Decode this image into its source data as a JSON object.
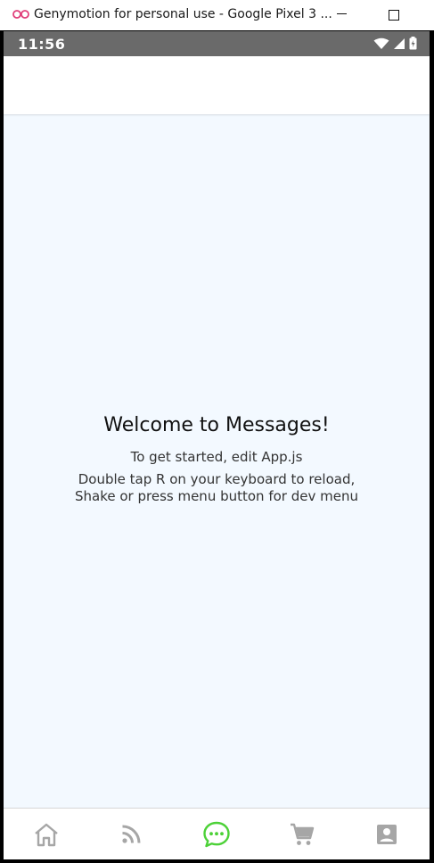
{
  "window": {
    "title": "Genymotion for personal use - Google Pixel 3 ...",
    "app_icon": "genymotion-logo",
    "minimize_icon": "minimize-icon",
    "maximize_icon": "maximize-icon"
  },
  "statusbar": {
    "time": "11:56",
    "icons": [
      "wifi-icon",
      "signal-icon",
      "battery-icon"
    ]
  },
  "content": {
    "title": "Welcome to Messages!",
    "line1": "To get started, edit App.js",
    "line2": "Double tap R on your keyboard to reload,",
    "line3": "Shake or press menu button for dev menu"
  },
  "tabbar": {
    "tabs": [
      {
        "icon": "home-icon",
        "active": false
      },
      {
        "icon": "rss-feed-icon",
        "active": false
      },
      {
        "icon": "chat-bubble-icon",
        "active": true
      },
      {
        "icon": "shopping-cart-icon",
        "active": false
      },
      {
        "icon": "account-box-icon",
        "active": false
      }
    ],
    "active_color": "#4cd137",
    "inactive_color": "#a6a6a6"
  },
  "colors": {
    "background": "#f3f9ff",
    "statusbar": "#6a6a6a"
  }
}
